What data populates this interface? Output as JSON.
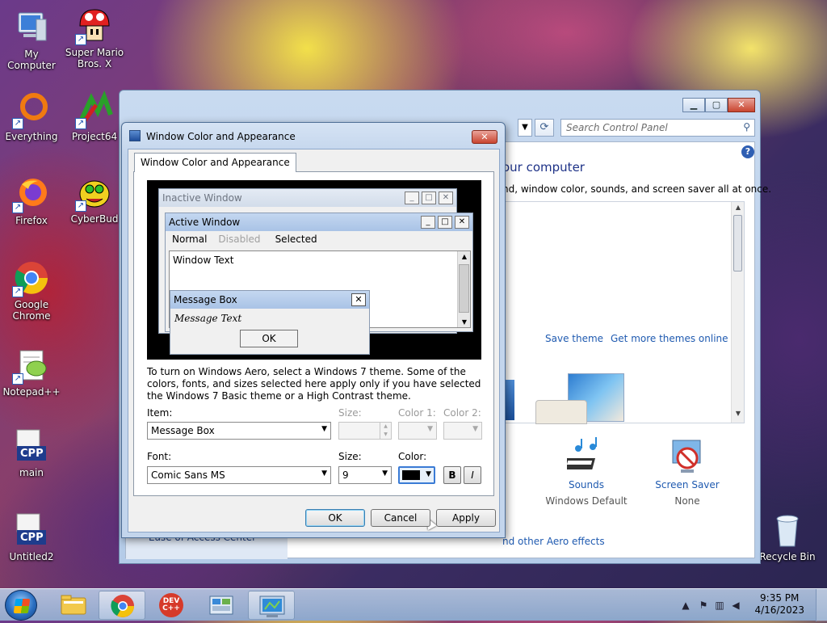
{
  "desktop": {
    "icons": [
      {
        "label": "My Computer",
        "icon": "computer-icon"
      },
      {
        "label": "Super Mario Bros. X",
        "icon": "mushroom-icon"
      },
      {
        "label": "Everything",
        "icon": "everything-icon"
      },
      {
        "label": "Project64",
        "icon": "project64-icon"
      },
      {
        "label": "Firefox",
        "icon": "firefox-icon"
      },
      {
        "label": "CyberBud",
        "icon": "cyberbud-icon"
      },
      {
        "label": "Google Chrome",
        "icon": "chrome-icon"
      },
      {
        "label": "Notepad++",
        "icon": "notepadpp-icon"
      },
      {
        "label": "main",
        "icon": "cpp-file-icon"
      },
      {
        "label": "Untitled2",
        "icon": "cpp-file-icon"
      },
      {
        "label": "Recycle Bin",
        "icon": "recycle-bin-icon"
      }
    ],
    "cpp_badge": "CPP"
  },
  "control_panel": {
    "search_placeholder": "Search Control Panel",
    "heading": "our computer",
    "subheading": "nd, window color, sounds, and screen saver all at once.",
    "save_theme": "Save theme",
    "get_more_themes": "Get more themes online",
    "sounds_title": "Sounds",
    "sounds_value": "Windows Default",
    "screensaver_title": "Screen Saver",
    "screensaver_value": "None",
    "aero_link": "nd other Aero effects",
    "ease_of_access": "Ease of Access Center",
    "help_glyph": "?"
  },
  "dialog": {
    "title": "Window Color and Appearance",
    "tab": "Window Color and Appearance",
    "preview": {
      "inactive_title": "Inactive Window",
      "active_title": "Active Window",
      "menu_normal": "Normal",
      "menu_disabled": "Disabled",
      "menu_selected": "Selected",
      "window_text": "Window Text",
      "msg_title": "Message Box",
      "msg_text": "Message Text",
      "msg_ok": "OK"
    },
    "info": "To turn on Windows Aero, select a Windows 7 theme.  Some of the colors, fonts, and sizes selected here apply only if you have selected the Windows 7 Basic theme or a High Contrast theme.",
    "item_label": "Item:",
    "item_value": "Message Box",
    "item_size_label": "Size:",
    "color1_label": "Color 1:",
    "color2_label": "Color 2:",
    "font_label": "Font:",
    "font_value": "Comic Sans MS",
    "font_size_label": "Size:",
    "font_size_value": "9",
    "font_color_label": "Color:",
    "font_color": "#000000",
    "bold_label": "B",
    "italic_label": "I",
    "ok": "OK",
    "cancel": "Cancel",
    "apply": "Apply"
  },
  "taskbar": {
    "time": "9:35 PM",
    "date": "4/16/2023",
    "pinned": [
      "file-explorer-icon",
      "chrome-icon",
      "devcpp-icon",
      "control-panel-icon",
      "display-settings-icon"
    ],
    "devcpp_label": "DEV C++"
  }
}
